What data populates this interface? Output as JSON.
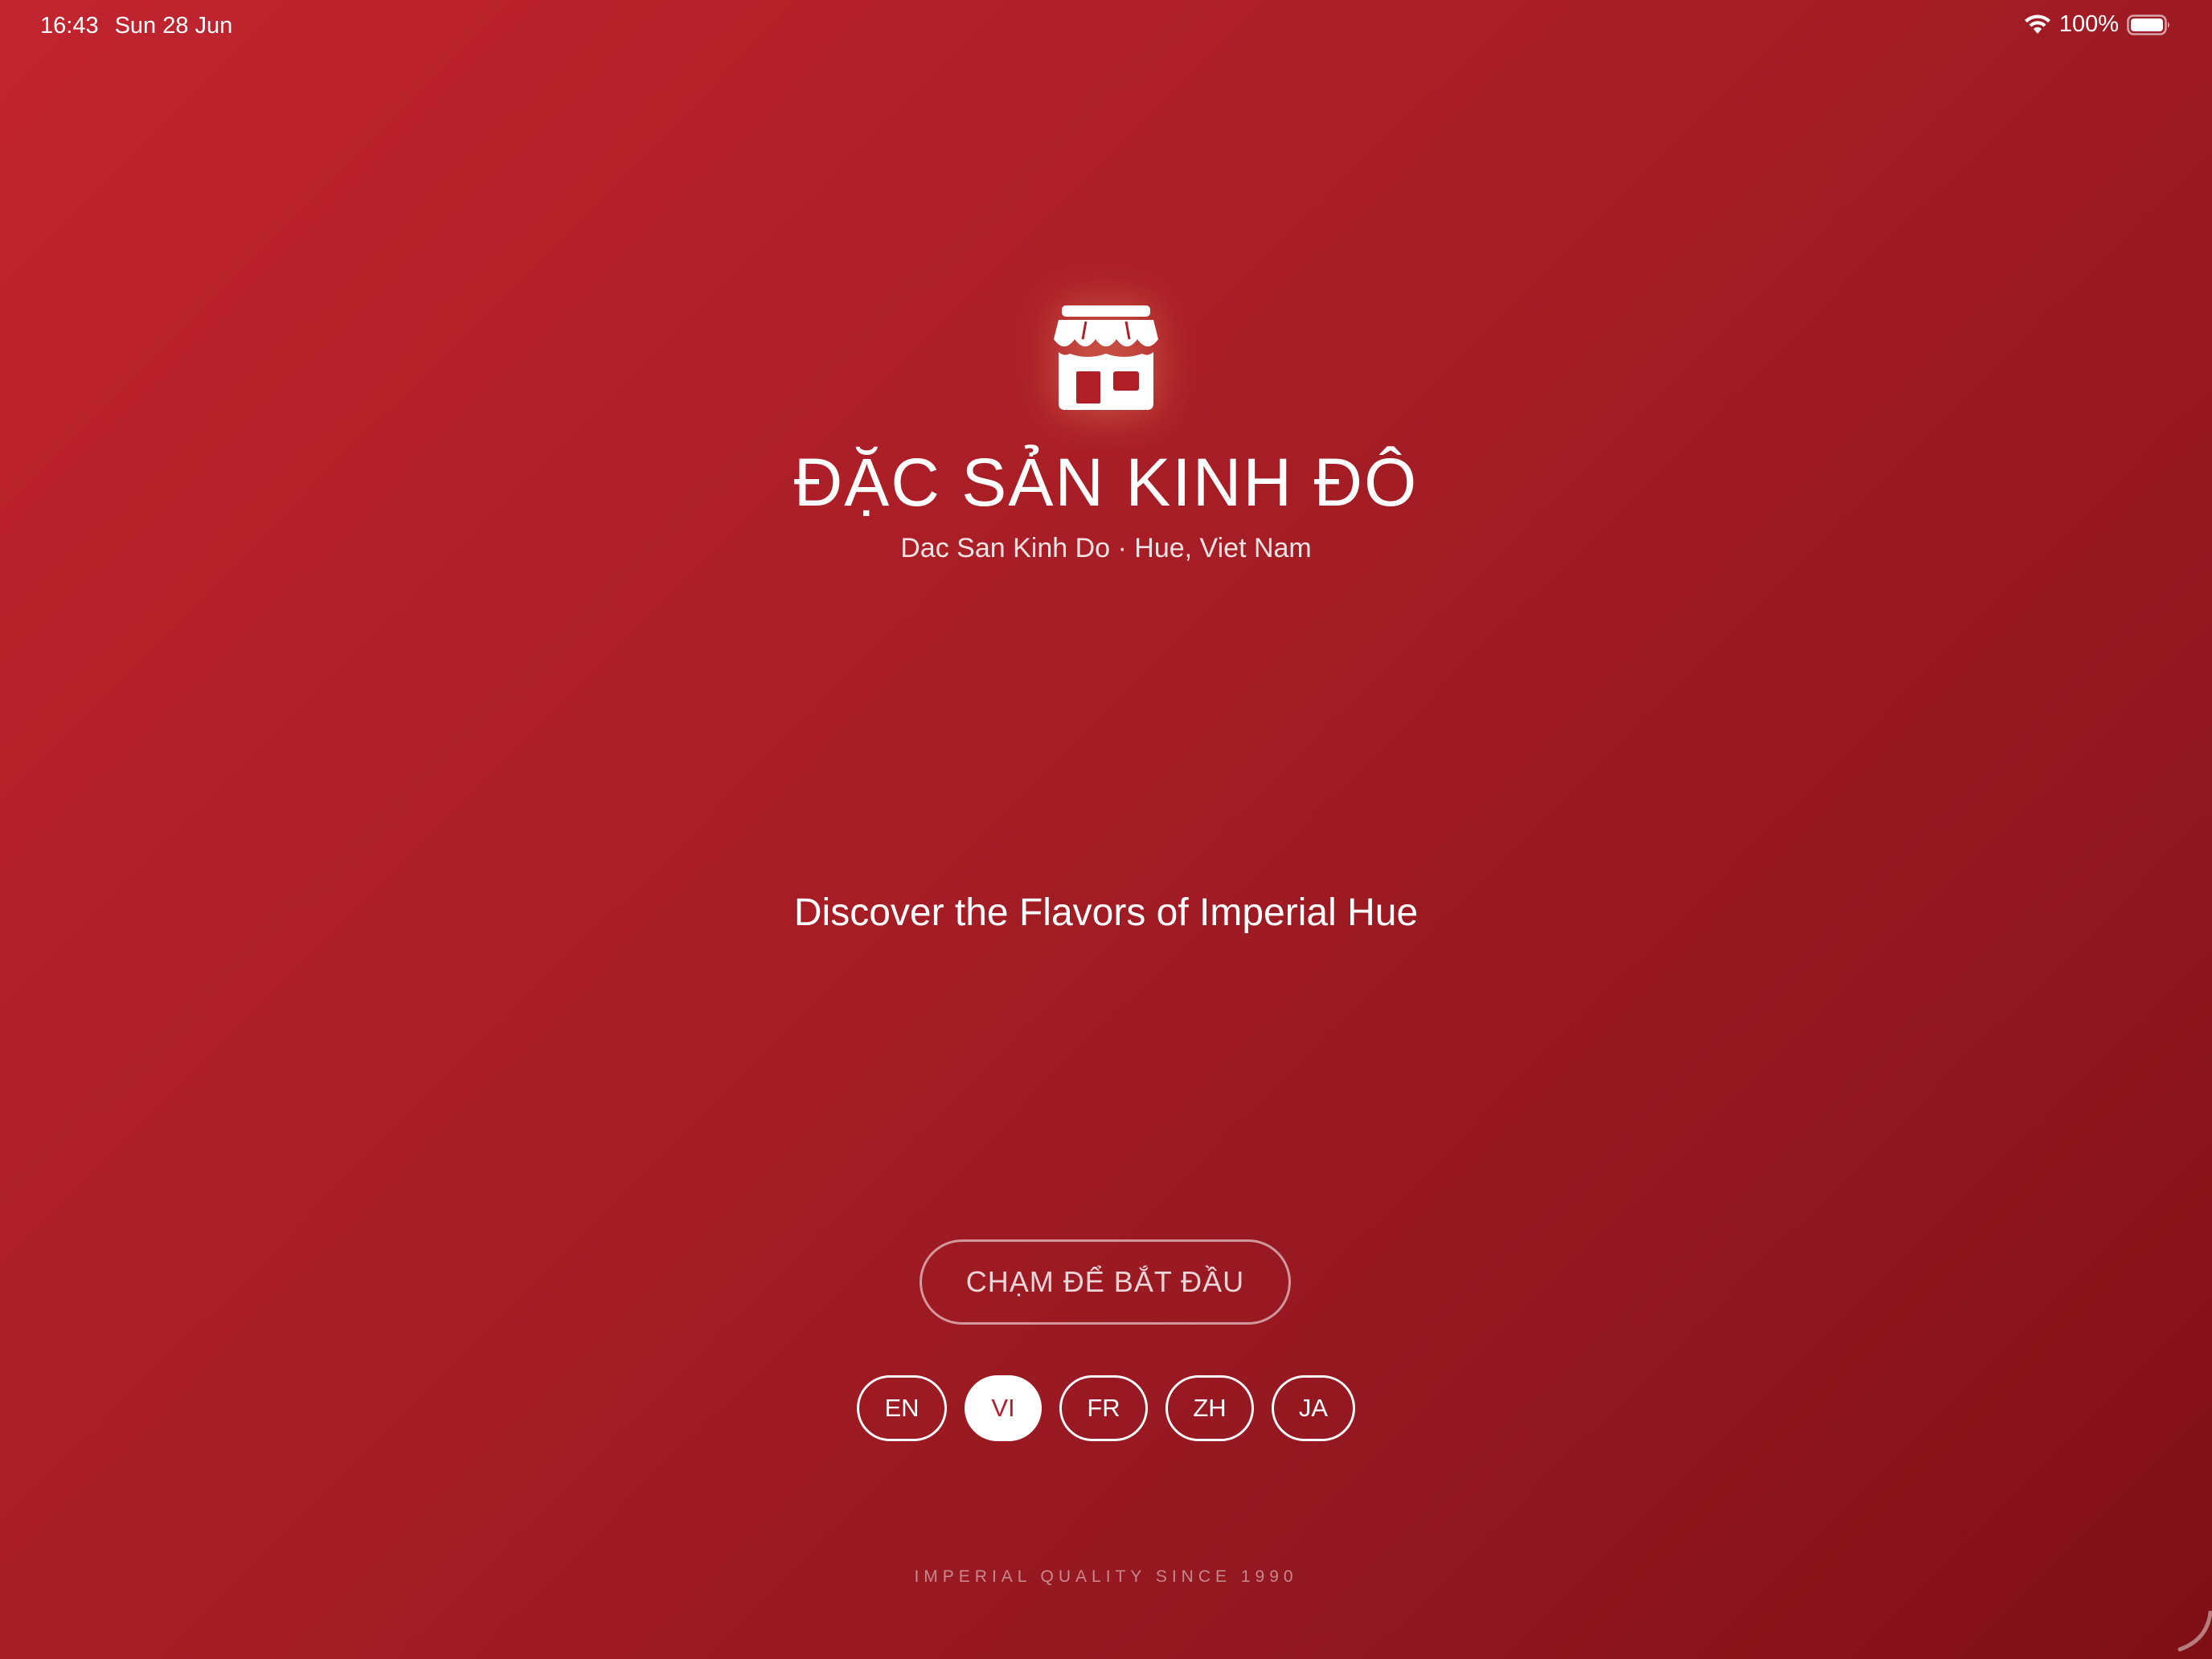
{
  "status_bar": {
    "time": "16:43",
    "date": "Sun 28 Jun",
    "battery": "100%",
    "icons": [
      "wifi-icon",
      "battery-icon"
    ]
  },
  "brand": {
    "icon": "store-icon",
    "title": "ĐẶC SẢN KINH ĐÔ",
    "subtitle": "Dac San Kinh Do · Hue, Viet Nam"
  },
  "tagline": "Discover the Flavors of Imperial Hue",
  "start_button": {
    "label": "CHẠM ĐỂ BẮT ĐẦU"
  },
  "languages": [
    {
      "code": "EN",
      "selected": false
    },
    {
      "code": "VI",
      "selected": true
    },
    {
      "code": "FR",
      "selected": false
    },
    {
      "code": "ZH",
      "selected": false
    },
    {
      "code": "JA",
      "selected": false
    }
  ],
  "footer": "IMPERIAL QUALITY SINCE 1990",
  "colors": {
    "background_start": "#c1252f",
    "background_end": "#7e1015",
    "accent": "#ffffff",
    "selected_text": "#b01f28"
  }
}
